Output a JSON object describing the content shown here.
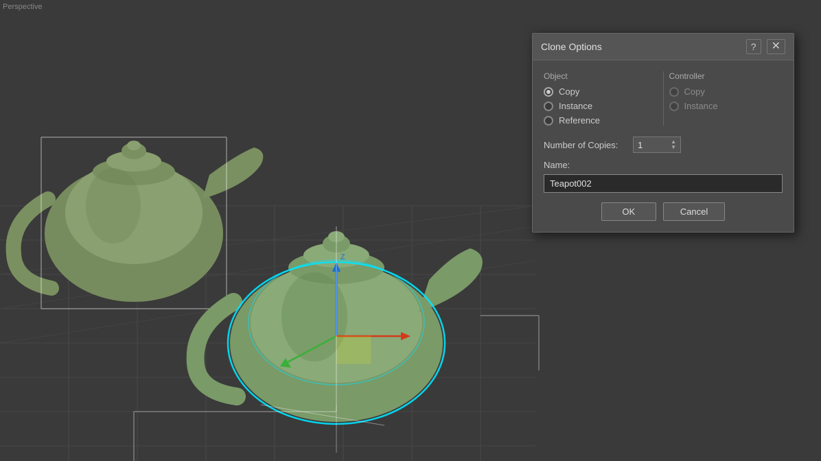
{
  "viewport": {
    "label": "Perspective"
  },
  "dialog": {
    "title": "Clone Options",
    "help_label": "?",
    "close_label": "✕",
    "object_section": {
      "label": "Object",
      "options": [
        {
          "id": "copy",
          "label": "Copy",
          "checked": true
        },
        {
          "id": "instance",
          "label": "Instance",
          "checked": false
        },
        {
          "id": "reference",
          "label": "Reference",
          "checked": false
        }
      ]
    },
    "controller_section": {
      "label": "Controller",
      "options": [
        {
          "id": "ctrl-copy",
          "label": "Copy",
          "checked": false
        },
        {
          "id": "ctrl-instance",
          "label": "Instance",
          "checked": false
        }
      ]
    },
    "copies_label": "Number of Copies:",
    "copies_value": "1",
    "name_label": "Name:",
    "name_value": "Teapot002",
    "ok_label": "OK",
    "cancel_label": "Cancel"
  }
}
